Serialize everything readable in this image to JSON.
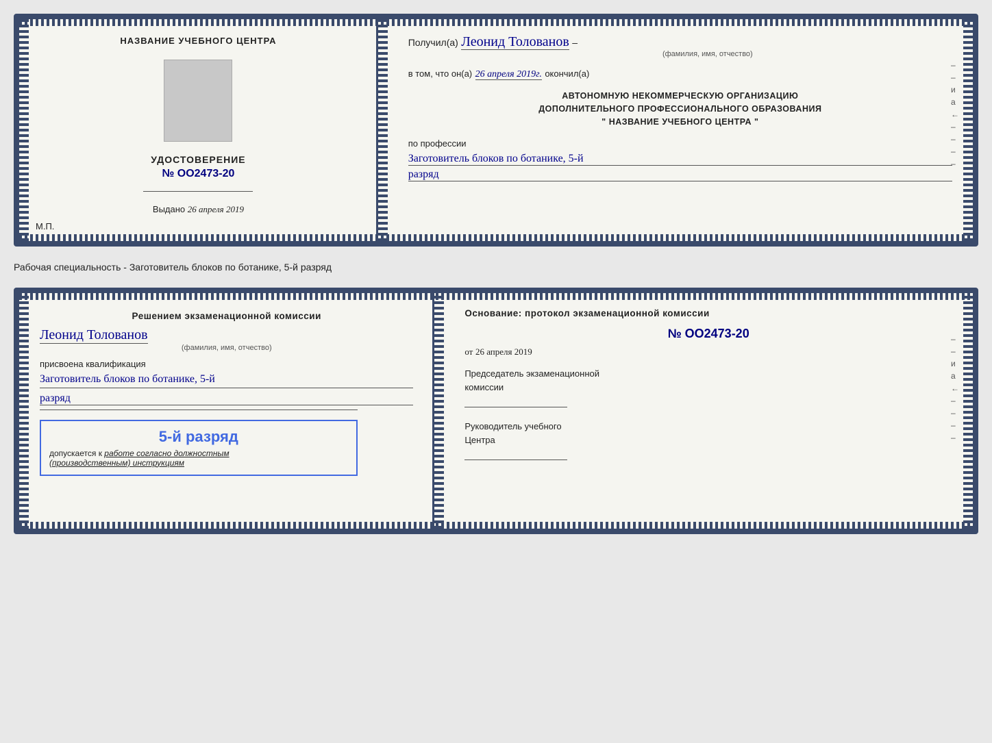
{
  "doc1": {
    "left": {
      "title": "НАЗВАНИЕ УЧЕБНОГО ЦЕНТРА",
      "cert_title": "УДОСТОВЕРЕНИЕ",
      "cert_number": "№ OO2473-20",
      "issued_label": "Выдано",
      "issued_date": "26 апреля 2019",
      "mp_label": "М.П."
    },
    "right": {
      "recipient_prefix": "Получил(а)",
      "recipient_name": "Леонид Толованов",
      "fio_label": "(фамилия, имя, отчество)",
      "certify_prefix": "в том, что он(а)",
      "certify_date": "26 апреля 2019г.",
      "certify_suffix": "окончил(а)",
      "org_line1": "АВТОНОМНУЮ НЕКОММЕРЧЕСКУЮ ОРГАНИЗАЦИЮ",
      "org_line2": "ДОПОЛНИТЕЛЬНОГО ПРОФЕССИОНАЛЬНОГО ОБРАЗОВАНИЯ",
      "org_line3": "\"   НАЗВАНИЕ УЧЕБНОГО ЦЕНТРА   \"",
      "profession_label": "по профессии",
      "profession_value": "Заготовитель блоков по ботанике, 5-й",
      "rank_value": "разряд"
    }
  },
  "between_text": "Рабочая специальность - Заготовитель блоков по ботанике, 5-й разряд",
  "doc2": {
    "left": {
      "commission_text": "Решением экзаменационной комиссии",
      "name": "Леонид Толованов",
      "fio_label": "(фамилия, имя, отчество)",
      "assigned_label": "присвоена квалификация",
      "qualification_value": "Заготовитель блоков по ботанике, 5-й",
      "rank_value": "разряд",
      "blue_box_rank": "5-й разряд",
      "допускается": "допускается к",
      "работе": "работе согласно должностным",
      "инструкциям": "(производственным) инструкциям"
    },
    "right": {
      "basis_title": "Основание: протокол экзаменационной комиссии",
      "protocol_number": "№  OO2473-20",
      "from_label": "от",
      "from_date": "26 апреля 2019",
      "chairman_label": "Председатель экзаменационной",
      "commission_label": "комиссии",
      "head_label1": "Руководитель учебного",
      "head_label2": "Центра"
    }
  },
  "side_labels": {
    "и": "и",
    "а": "а",
    "left_arrow": "←"
  }
}
